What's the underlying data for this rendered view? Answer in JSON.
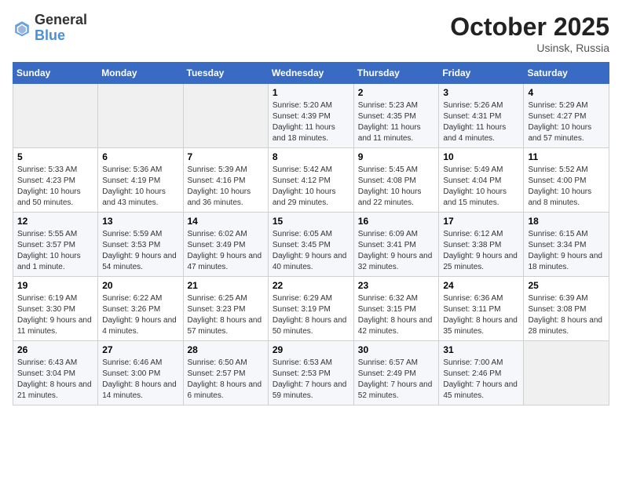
{
  "header": {
    "logo_general": "General",
    "logo_blue": "Blue",
    "month_title": "October 2025",
    "subtitle": "Usinsk, Russia"
  },
  "days_of_week": [
    "Sunday",
    "Monday",
    "Tuesday",
    "Wednesday",
    "Thursday",
    "Friday",
    "Saturday"
  ],
  "weeks": [
    [
      {
        "num": "",
        "info": ""
      },
      {
        "num": "",
        "info": ""
      },
      {
        "num": "",
        "info": ""
      },
      {
        "num": "1",
        "info": "Sunrise: 5:20 AM\nSunset: 4:39 PM\nDaylight: 11 hours and 18 minutes."
      },
      {
        "num": "2",
        "info": "Sunrise: 5:23 AM\nSunset: 4:35 PM\nDaylight: 11 hours and 11 minutes."
      },
      {
        "num": "3",
        "info": "Sunrise: 5:26 AM\nSunset: 4:31 PM\nDaylight: 11 hours and 4 minutes."
      },
      {
        "num": "4",
        "info": "Sunrise: 5:29 AM\nSunset: 4:27 PM\nDaylight: 10 hours and 57 minutes."
      }
    ],
    [
      {
        "num": "5",
        "info": "Sunrise: 5:33 AM\nSunset: 4:23 PM\nDaylight: 10 hours and 50 minutes."
      },
      {
        "num": "6",
        "info": "Sunrise: 5:36 AM\nSunset: 4:19 PM\nDaylight: 10 hours and 43 minutes."
      },
      {
        "num": "7",
        "info": "Sunrise: 5:39 AM\nSunset: 4:16 PM\nDaylight: 10 hours and 36 minutes."
      },
      {
        "num": "8",
        "info": "Sunrise: 5:42 AM\nSunset: 4:12 PM\nDaylight: 10 hours and 29 minutes."
      },
      {
        "num": "9",
        "info": "Sunrise: 5:45 AM\nSunset: 4:08 PM\nDaylight: 10 hours and 22 minutes."
      },
      {
        "num": "10",
        "info": "Sunrise: 5:49 AM\nSunset: 4:04 PM\nDaylight: 10 hours and 15 minutes."
      },
      {
        "num": "11",
        "info": "Sunrise: 5:52 AM\nSunset: 4:00 PM\nDaylight: 10 hours and 8 minutes."
      }
    ],
    [
      {
        "num": "12",
        "info": "Sunrise: 5:55 AM\nSunset: 3:57 PM\nDaylight: 10 hours and 1 minute."
      },
      {
        "num": "13",
        "info": "Sunrise: 5:59 AM\nSunset: 3:53 PM\nDaylight: 9 hours and 54 minutes."
      },
      {
        "num": "14",
        "info": "Sunrise: 6:02 AM\nSunset: 3:49 PM\nDaylight: 9 hours and 47 minutes."
      },
      {
        "num": "15",
        "info": "Sunrise: 6:05 AM\nSunset: 3:45 PM\nDaylight: 9 hours and 40 minutes."
      },
      {
        "num": "16",
        "info": "Sunrise: 6:09 AM\nSunset: 3:41 PM\nDaylight: 9 hours and 32 minutes."
      },
      {
        "num": "17",
        "info": "Sunrise: 6:12 AM\nSunset: 3:38 PM\nDaylight: 9 hours and 25 minutes."
      },
      {
        "num": "18",
        "info": "Sunrise: 6:15 AM\nSunset: 3:34 PM\nDaylight: 9 hours and 18 minutes."
      }
    ],
    [
      {
        "num": "19",
        "info": "Sunrise: 6:19 AM\nSunset: 3:30 PM\nDaylight: 9 hours and 11 minutes."
      },
      {
        "num": "20",
        "info": "Sunrise: 6:22 AM\nSunset: 3:26 PM\nDaylight: 9 hours and 4 minutes."
      },
      {
        "num": "21",
        "info": "Sunrise: 6:25 AM\nSunset: 3:23 PM\nDaylight: 8 hours and 57 minutes."
      },
      {
        "num": "22",
        "info": "Sunrise: 6:29 AM\nSunset: 3:19 PM\nDaylight: 8 hours and 50 minutes."
      },
      {
        "num": "23",
        "info": "Sunrise: 6:32 AM\nSunset: 3:15 PM\nDaylight: 8 hours and 42 minutes."
      },
      {
        "num": "24",
        "info": "Sunrise: 6:36 AM\nSunset: 3:11 PM\nDaylight: 8 hours and 35 minutes."
      },
      {
        "num": "25",
        "info": "Sunrise: 6:39 AM\nSunset: 3:08 PM\nDaylight: 8 hours and 28 minutes."
      }
    ],
    [
      {
        "num": "26",
        "info": "Sunrise: 6:43 AM\nSunset: 3:04 PM\nDaylight: 8 hours and 21 minutes."
      },
      {
        "num": "27",
        "info": "Sunrise: 6:46 AM\nSunset: 3:00 PM\nDaylight: 8 hours and 14 minutes."
      },
      {
        "num": "28",
        "info": "Sunrise: 6:50 AM\nSunset: 2:57 PM\nDaylight: 8 hours and 6 minutes."
      },
      {
        "num": "29",
        "info": "Sunrise: 6:53 AM\nSunset: 2:53 PM\nDaylight: 7 hours and 59 minutes."
      },
      {
        "num": "30",
        "info": "Sunrise: 6:57 AM\nSunset: 2:49 PM\nDaylight: 7 hours and 52 minutes."
      },
      {
        "num": "31",
        "info": "Sunrise: 7:00 AM\nSunset: 2:46 PM\nDaylight: 7 hours and 45 minutes."
      },
      {
        "num": "",
        "info": ""
      }
    ]
  ]
}
